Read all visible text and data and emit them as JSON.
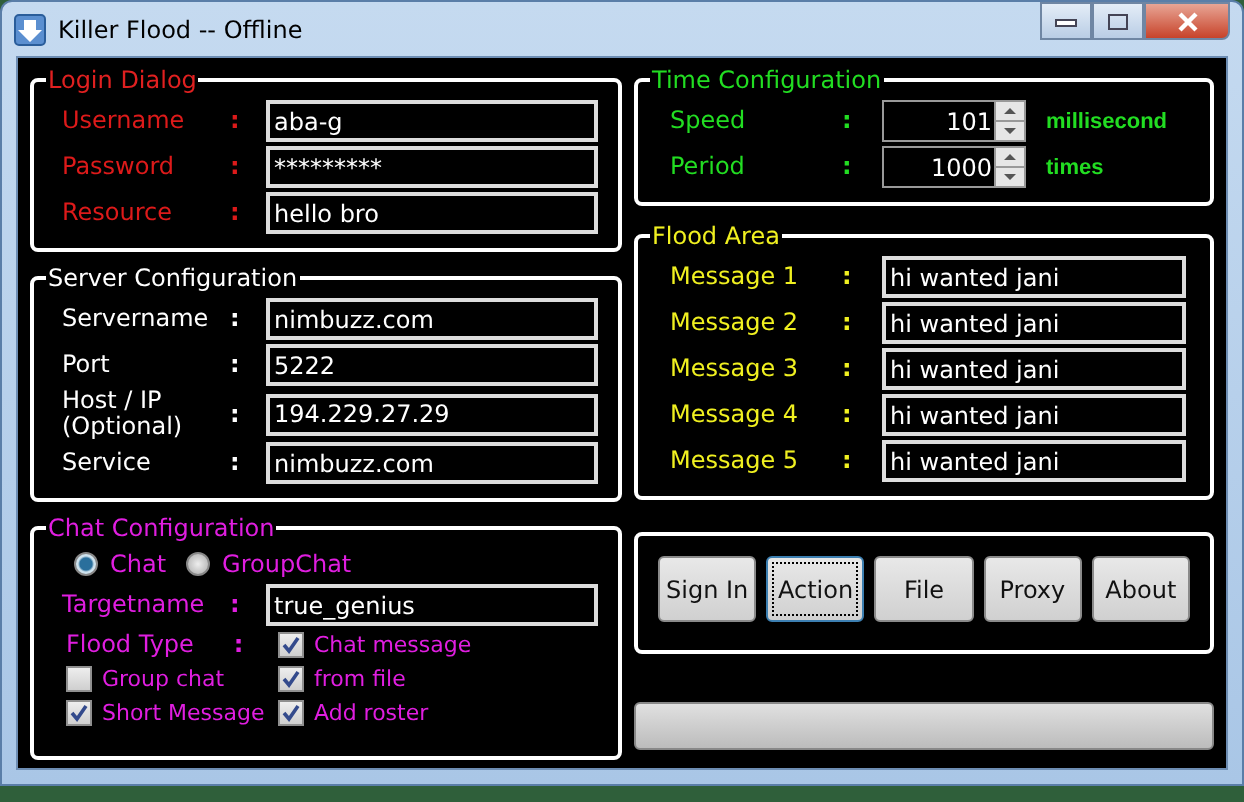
{
  "window": {
    "title": "Killer Flood -- Offline"
  },
  "login": {
    "title": "Login Dialog",
    "fields": [
      {
        "label": "Username",
        "colon": ":",
        "value": "aba-g"
      },
      {
        "label": "Password",
        "colon": ":",
        "value": "*********"
      },
      {
        "label": "Resource",
        "colon": ":",
        "value": "hello bro"
      }
    ]
  },
  "server": {
    "title": "Server Configuration",
    "fields": [
      {
        "label": "Servername",
        "colon": ":",
        "value": "nimbuzz.com"
      },
      {
        "label": "Port",
        "colon": ":",
        "value": "5222"
      },
      {
        "label": "Host / IP (Optional)",
        "colon": ":",
        "value": "194.229.27.29"
      },
      {
        "label": "Service",
        "colon": ":",
        "value": "nimbuzz.com"
      }
    ]
  },
  "chat": {
    "title": "Chat Configuration",
    "modes": [
      {
        "label": "Chat",
        "selected": true
      },
      {
        "label": "GroupChat",
        "selected": false
      }
    ],
    "target": {
      "label": "Targetname",
      "colon": ":",
      "value": "true_genius"
    },
    "flood_type": {
      "label": "Flood Type",
      "colon": ":"
    },
    "options": [
      {
        "label": "Chat message",
        "checked": true
      },
      {
        "label": "Group chat",
        "checked": false
      },
      {
        "label": "from file",
        "checked": true
      },
      {
        "label": "Short Message",
        "checked": true
      },
      {
        "label": "Add roster",
        "checked": true
      }
    ]
  },
  "time": {
    "title": "Time Configuration",
    "rows": [
      {
        "label": "Speed",
        "colon": ":",
        "value": "101",
        "unit": "millisecond"
      },
      {
        "label": "Period",
        "colon": ":",
        "value": "1000",
        "unit": "times"
      }
    ]
  },
  "flood": {
    "title": "Flood Area",
    "messages": [
      {
        "label": "Message 1",
        "colon": ":",
        "value": "hi wanted jani"
      },
      {
        "label": "Message 2",
        "colon": ":",
        "value": "hi wanted jani"
      },
      {
        "label": "Message 3",
        "colon": ":",
        "value": "hi wanted jani"
      },
      {
        "label": "Message 4",
        "colon": ":",
        "value": "hi wanted jani"
      },
      {
        "label": "Message 5",
        "colon": ":",
        "value": "hi wanted jani"
      }
    ]
  },
  "buttons": [
    {
      "label": "Sign In",
      "focused": false
    },
    {
      "label": "Action",
      "focused": true
    },
    {
      "label": "File",
      "focused": false
    },
    {
      "label": "Proxy",
      "focused": false
    },
    {
      "label": "About",
      "focused": false
    }
  ],
  "progress": {
    "level": 0
  }
}
